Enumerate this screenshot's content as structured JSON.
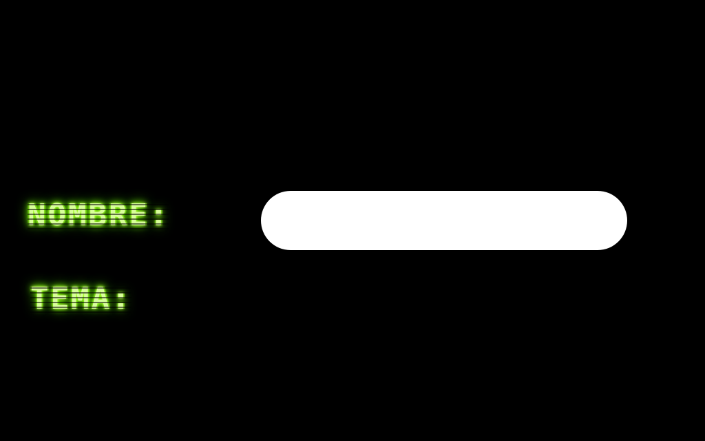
{
  "form": {
    "name_label": "NOMBRE:",
    "name_value": "",
    "theme_label": "TEMA:"
  },
  "colors": {
    "background": "#000000",
    "label_glow": "#7cff00",
    "label_text": "#d8ff9a",
    "input_background": "#ffffff"
  }
}
